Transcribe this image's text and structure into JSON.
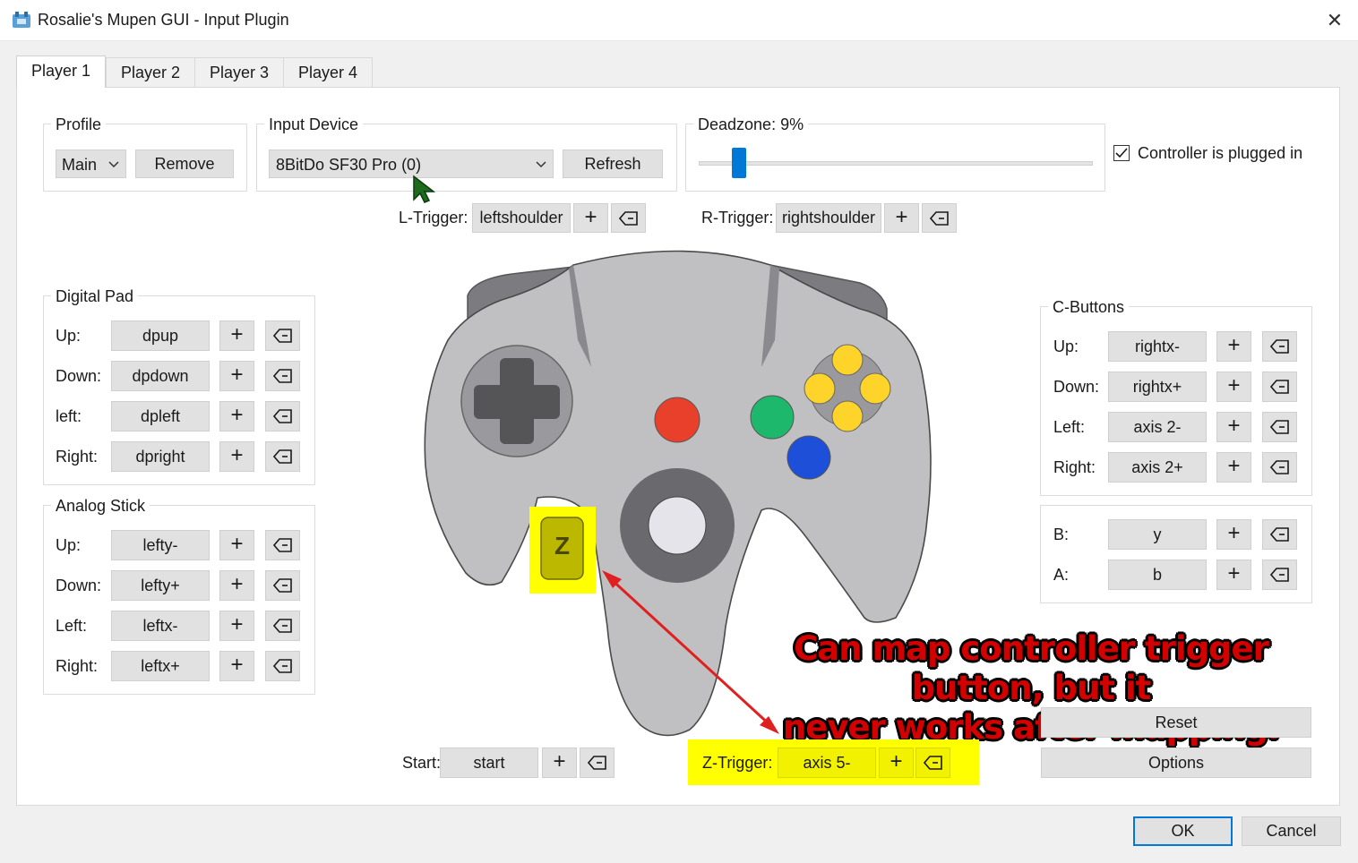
{
  "window": {
    "title": "Rosalie's Mupen GUI - Input Plugin",
    "close_glyph": "✕"
  },
  "tabs": [
    {
      "label": "Player 1"
    },
    {
      "label": "Player 2"
    },
    {
      "label": "Player 3"
    },
    {
      "label": "Player 4"
    }
  ],
  "profile": {
    "group_label": "Profile",
    "selected": "Main",
    "remove_label": "Remove"
  },
  "input_device": {
    "group_label": "Input Device",
    "selected": "8BitDo SF30 Pro (0)",
    "refresh_label": "Refresh"
  },
  "deadzone": {
    "label": "Deadzone: 9%",
    "value_percent": 9
  },
  "plugged_in": {
    "label": "Controller is plugged in",
    "checked": true
  },
  "l_trigger": {
    "label": "L-Trigger:",
    "value": "leftshoulder"
  },
  "r_trigger": {
    "label": "R-Trigger:",
    "value": "rightshoulder"
  },
  "digital_pad": {
    "group_label": "Digital Pad",
    "rows": [
      {
        "label": "Up:",
        "value": "dpup"
      },
      {
        "label": "Down:",
        "value": "dpdown"
      },
      {
        "label": "left:",
        "value": "dpleft"
      },
      {
        "label": "Right:",
        "value": "dpright"
      }
    ]
  },
  "analog_stick": {
    "group_label": "Analog Stick",
    "rows": [
      {
        "label": "Up:",
        "value": "lefty-"
      },
      {
        "label": "Down:",
        "value": "lefty+"
      },
      {
        "label": "Left:",
        "value": "leftx-"
      },
      {
        "label": "Right:",
        "value": "leftx+"
      }
    ]
  },
  "c_buttons": {
    "group_label": "C-Buttons",
    "rows": [
      {
        "label": "Up:",
        "value": "rightx-"
      },
      {
        "label": "Down:",
        "value": "rightx+"
      },
      {
        "label": "Left:",
        "value": "axis 2-"
      },
      {
        "label": "Right:",
        "value": "axis 2+"
      }
    ]
  },
  "ab_buttons": {
    "rows": [
      {
        "label": "B:",
        "value": "y"
      },
      {
        "label": "A:",
        "value": "b"
      }
    ]
  },
  "start": {
    "label": "Start:",
    "value": "start"
  },
  "z_trigger": {
    "label": "Z-Trigger:",
    "value": "axis 5-",
    "glyph": "Z"
  },
  "controller_colors": {
    "body": "#c0c0c2",
    "red": "#e8402a",
    "green": "#1db86c",
    "blue": "#1e4fd8",
    "yellow": "#ffd42a",
    "highlight": "#ffff00"
  },
  "annotation": {
    "line1": "Can map controller trigger button, but it",
    "line2": "never works after mapping."
  },
  "actions": {
    "reset_label": "Reset",
    "options_label": "Options",
    "ok_label": "OK",
    "cancel_label": "Cancel"
  },
  "glyphs": {
    "add": "+"
  }
}
